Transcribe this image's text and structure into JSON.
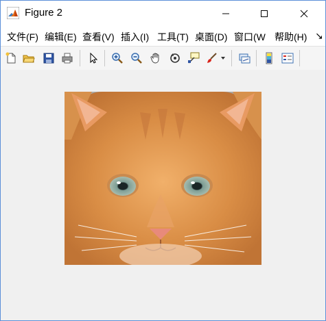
{
  "window": {
    "title": "Figure 2"
  },
  "menu": [
    "文件(F)",
    "编辑(E)",
    "查看(V)",
    "插入(I)",
    "工具(T)",
    "桌面(D)",
    "窗口(W",
    "帮助(H)"
  ],
  "toolbar": {
    "overflow_glyph": "↘",
    "icons": [
      "new-figure-icon",
      "open-file-icon",
      "save-icon",
      "print-icon",
      "select-arrow-icon",
      "zoom-in-icon",
      "zoom-out-icon",
      "pan-hand-icon",
      "rotate-3d-icon",
      "data-cursor-icon",
      "brush-icon",
      "brush-dropdown-icon",
      "link-plot-icon",
      "colorbar-icon",
      "legend-icon"
    ]
  },
  "colors": {
    "accent": "#0078d7",
    "frame": "#5b8fd8",
    "canvas": "#f0f0f0"
  },
  "figure": {
    "image_subject": "orange kitten face"
  }
}
